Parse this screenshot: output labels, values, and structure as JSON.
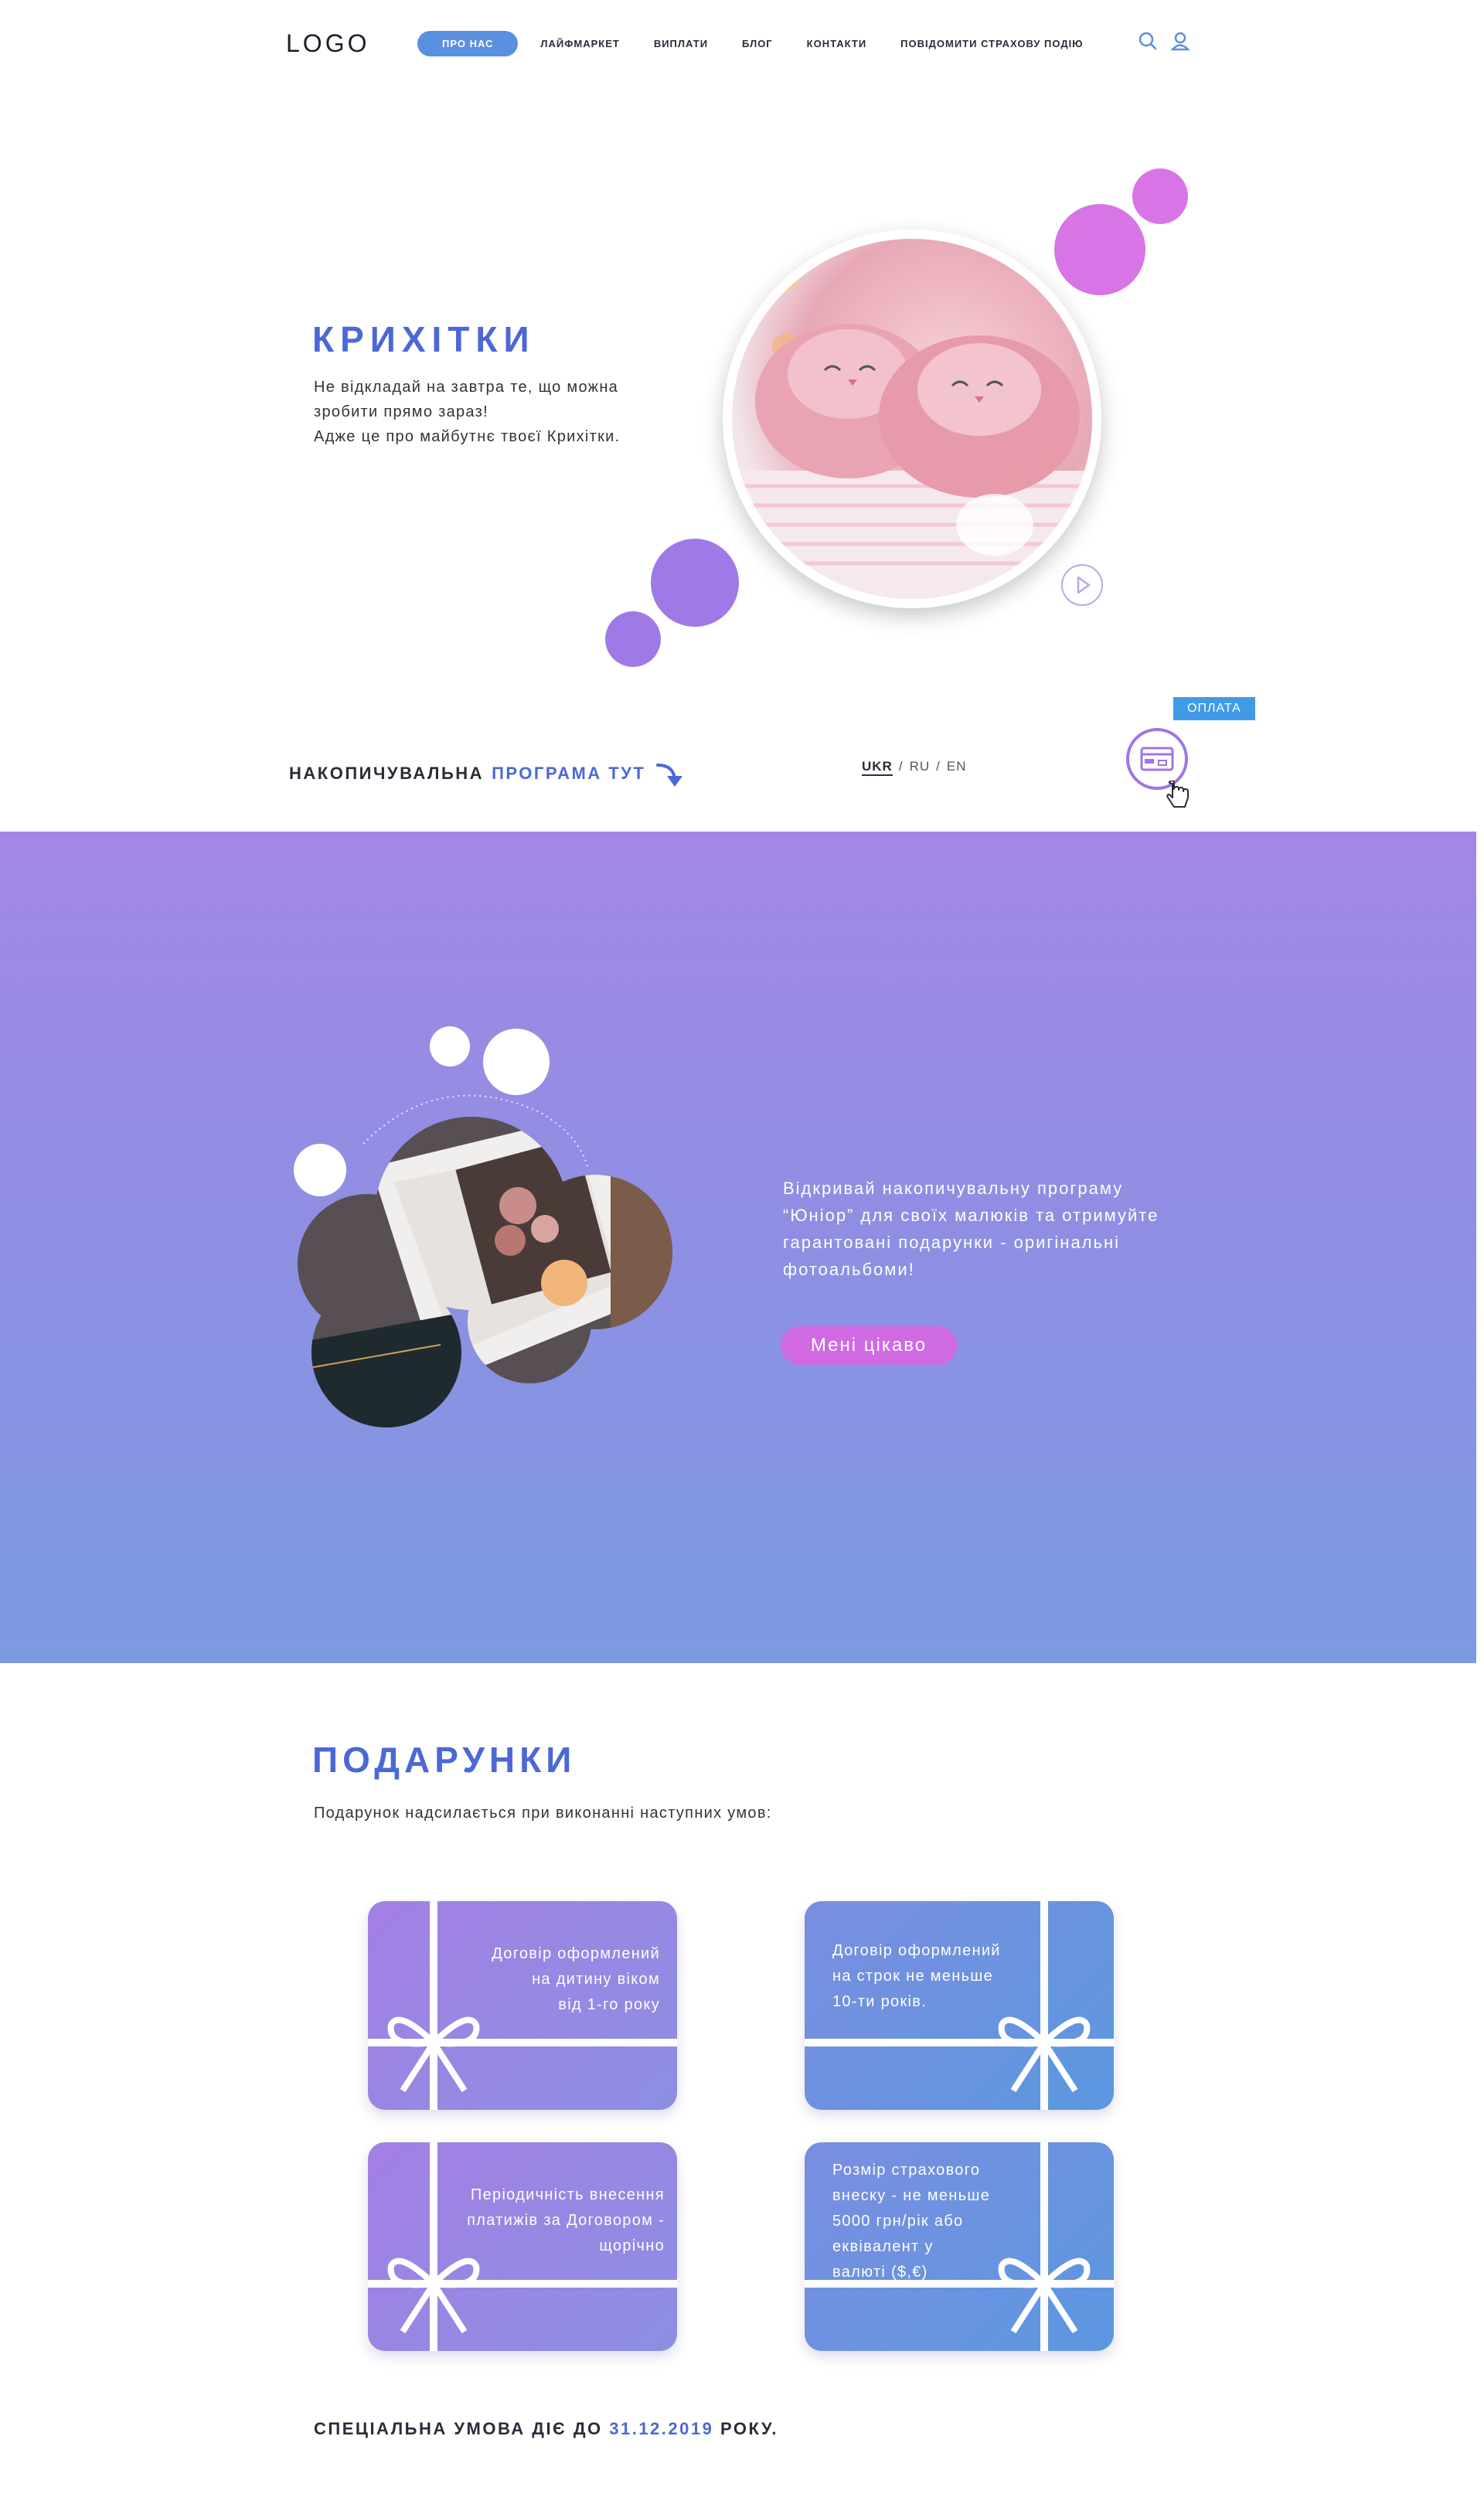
{
  "header": {
    "logo": "LOGO",
    "nav": [
      {
        "label": "ПРО НАС",
        "active": true
      },
      {
        "label": "ЛАЙФМАРКЕТ"
      },
      {
        "label": "ВИПЛАТИ"
      },
      {
        "label": "БЛОГ"
      },
      {
        "label": "КОНТАКТИ"
      },
      {
        "label": "ПОВІДОМИТИ СТРАХОВУ ПОДІЮ"
      }
    ],
    "icons": [
      "search-icon",
      "user-icon"
    ]
  },
  "hero": {
    "title": "КРИХІТКИ",
    "text_line1": "Не відкладай на завтра те, що можна",
    "text_line2": "зробити прямо зараз!",
    "text_line3": "Адже це про майбутнє твоєї Крихітки."
  },
  "program": {
    "label": "НАКОПИЧУВАЛЬНА",
    "link": "ПРОГРАМА ТУТ"
  },
  "languages": [
    {
      "code": "UKR",
      "active": true
    },
    {
      "code": "RU"
    },
    {
      "code": "EN"
    }
  ],
  "payment": {
    "label": "ОПЛАТА"
  },
  "promo": {
    "line1": "Відкривай накопичувальну програму",
    "line2": "“Юніор” для своїх малюків та отримуйте",
    "line3": "гарантовані подарунки - оригінальні",
    "line4": "фотоальбоми!",
    "button": "Мені цікаво"
  },
  "gifts": {
    "title": "ПОДАРУНКИ",
    "subtitle": "Подарунок надсилається при виконанні наступних умов:",
    "cards": [
      {
        "lines": [
          "Договір оформлений",
          "на дитину віком",
          "від 1-го року"
        ]
      },
      {
        "lines": [
          "Договір оформлений",
          "на строк не меньше",
          "10-ти років."
        ]
      },
      {
        "lines": [
          "Періодичність внесення",
          "платижів за Договором -",
          "щорічно"
        ]
      },
      {
        "lines": [
          "Розмір страхового",
          "внеску - не меньше",
          "5000 грн/рік або",
          "еквівалент у",
          "валюті ($,€)"
        ]
      }
    ]
  },
  "special": {
    "prefix": "СПЕЦІАЛЬНА УМОВА ДІЄ ДО",
    "date": "31.12.2019",
    "suffix": "РОКУ."
  },
  "colors": {
    "accent_blue": "#4c68d6",
    "nav_active": "#5b8fe0",
    "purple_circle": "#9f7ae6",
    "pink_circle": "#d874e6",
    "button_pink": "#d06ae3",
    "pay_blue": "#3f9be8"
  }
}
